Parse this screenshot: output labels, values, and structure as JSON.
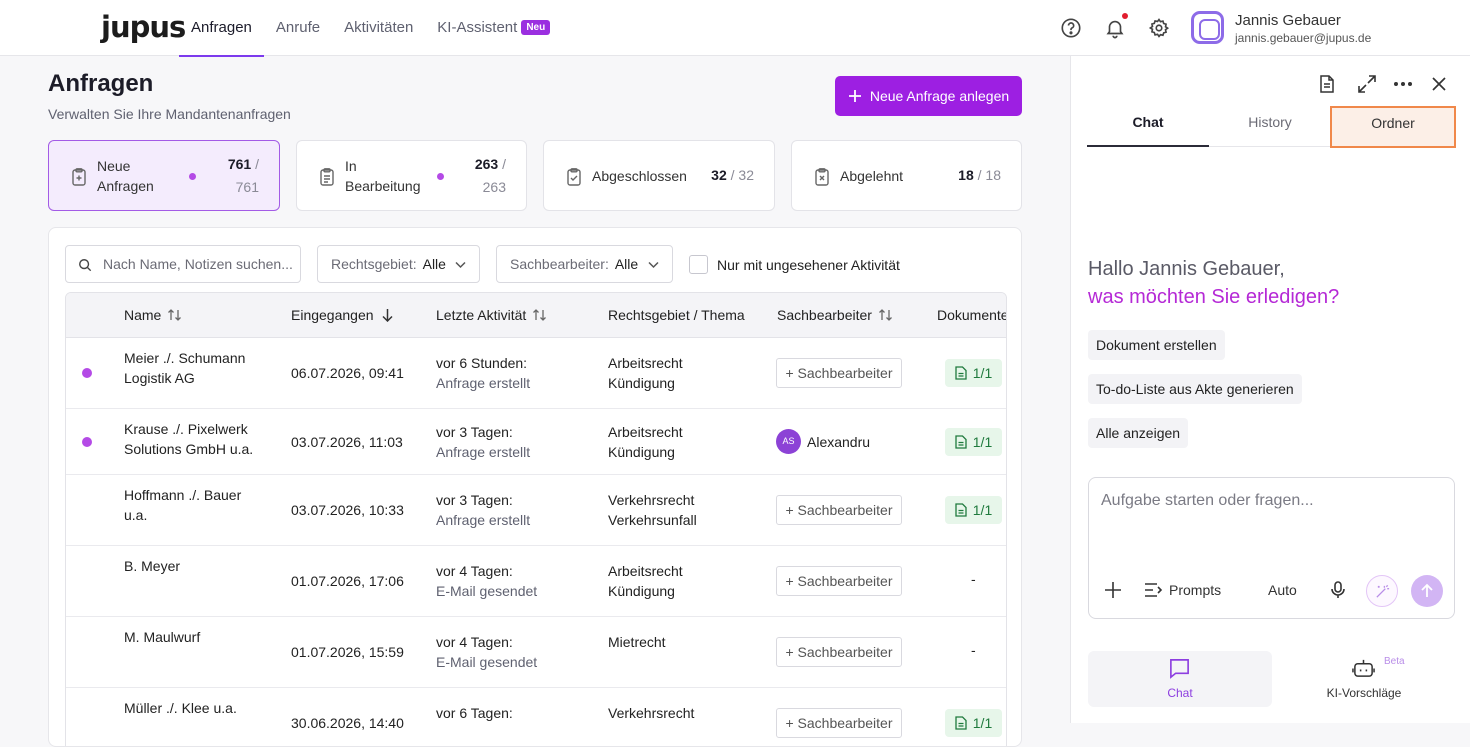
{
  "app": {
    "logo": "jupus"
  },
  "nav": [
    {
      "label": "Anfragen",
      "active": true
    },
    {
      "label": "Anrufe"
    },
    {
      "label": "Aktivitäten"
    },
    {
      "label": "KI-Assistent",
      "badge": "Neu"
    }
  ],
  "topbar": {
    "icons": [
      "help-icon",
      "bell-icon",
      "settings-icon"
    ],
    "user": {
      "name": "Jannis Gebauer",
      "email": "jannis.gebauer@jupus.de"
    }
  },
  "page": {
    "title": "Anfragen",
    "subtitle": "Verwalten Sie Ihre Mandantenanfragen",
    "new_button": "Neue Anfrage anlegen"
  },
  "cards": [
    {
      "label1": "Neue",
      "label2": "Anfragen",
      "count": "761",
      "total_a": " /",
      "total_b": "761",
      "dot": true,
      "selected": true
    },
    {
      "label1": "In",
      "label2": "Bearbeitung",
      "count": "263",
      "total_a": " /",
      "total_b": "263",
      "dot": true
    },
    {
      "label1": "Abgeschlossen",
      "count": "32",
      "total": " / 32"
    },
    {
      "label1": "Abgelehnt",
      "count": "18",
      "total": " / 18"
    }
  ],
  "filters": {
    "search_placeholder": "Nach Name, Notizen suchen...",
    "rechtsgebiet_label": "Rechtsgebiet:",
    "rechtsgebiet_value": "Alle",
    "sachbearbeiter_label": "Sachbearbeiter:",
    "sachbearbeiter_value": "Alle",
    "unseen_label": "Nur mit ungesehener Aktivität"
  },
  "table": {
    "columns": [
      "Name",
      "Eingegangen",
      "Letzte Aktivität",
      "Rechtsgebiet / Thema",
      "Sachbearbeiter",
      "Dokumente"
    ],
    "rows": [
      {
        "name1": "Meier ./. Schumann",
        "name2": "Logistik AG",
        "received": "06.07.2026, 09:41",
        "act1": "vor 6 Stunden:",
        "act2": "Anfrage erstellt",
        "area1": "Arbeitsrecht",
        "area2": "Kündigung",
        "assignee": "+ Sachbearbeiter",
        "docs": "1/1",
        "unread": true
      },
      {
        "name1": "Krause ./. Pixelwerk",
        "name2": "Solutions GmbH u.a.",
        "received": "03.07.2026, 11:03",
        "act1": "vor 3 Tagen:",
        "act2": "Anfrage erstellt",
        "area1": "Arbeitsrecht",
        "area2": "Kündigung",
        "assignee_initials": "AS",
        "assignee_name": "Alexandru",
        "docs": "1/1",
        "unread": true
      },
      {
        "name1": "Hoffmann ./. Bauer",
        "name2": "u.a.",
        "received": "03.07.2026, 10:33",
        "act1": "vor 3 Tagen:",
        "act2": "Anfrage erstellt",
        "area1": "Verkehrsrecht",
        "area2": "Verkehrsunfall",
        "assignee": "+ Sachbearbeiter",
        "docs": "1/1"
      },
      {
        "name1": "B. Meyer",
        "received": "01.07.2026, 17:06",
        "act1": "vor 4 Tagen:",
        "act2": "E-Mail gesendet",
        "area1": "Arbeitsrecht",
        "area2": "Kündigung",
        "assignee": "+ Sachbearbeiter",
        "docs": "-"
      },
      {
        "name1": "M. Maulwurf",
        "received": "01.07.2026, 15:59",
        "act1": "vor 4 Tagen:",
        "act2": "E-Mail gesendet",
        "area1": "Mietrecht",
        "assignee": "+ Sachbearbeiter",
        "docs": "-"
      },
      {
        "name1": "Müller ./. Klee u.a.",
        "received": "30.06.2026, 14:40",
        "act1": "vor 6 Tagen:",
        "area1": "Verkehrsrecht",
        "assignee": "+ Sachbearbeiter",
        "docs": "1/1"
      }
    ]
  },
  "assistant": {
    "tabs": [
      "Chat",
      "History",
      "Ordner"
    ],
    "greeting_line1": "Hallo Jannis Gebauer,",
    "greeting_line2": "was möchten Sie erledigen?",
    "suggestions": [
      "Dokument erstellen",
      "To-do-Liste aus Akte generieren",
      "Alle anzeigen"
    ],
    "input_placeholder": "Aufgabe starten oder fragen...",
    "prompts_label": "Prompts",
    "mode_label": "Auto",
    "bottom_tabs": [
      {
        "label": "Chat",
        "active": true
      },
      {
        "label": "KI-Vorschläge",
        "badge": "Beta"
      }
    ]
  },
  "colors": {
    "accent": "#9d1fe2",
    "dot": "#b44ae6",
    "highlight": "#f0884a"
  }
}
